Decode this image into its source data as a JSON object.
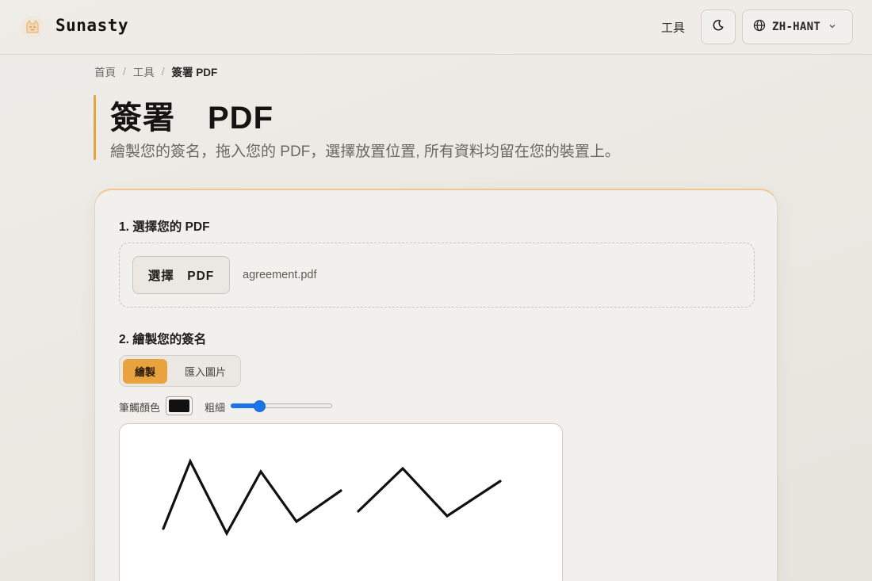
{
  "header": {
    "brand": "Sunasty",
    "nav_tools": "工具",
    "language": "ZH-HANT",
    "icons": {
      "logo": "cat-logo-icon",
      "theme": "moon-icon",
      "language": "globe-icon",
      "dropdown": "chevron-down-icon"
    }
  },
  "breadcrumb": {
    "home": "首頁",
    "tools": "工具",
    "current": "簽署 PDF",
    "separator": "/"
  },
  "page": {
    "title": "簽署　PDF",
    "subtitle": "繪製您的簽名，拖入您的 PDF，選擇放置位置, 所有資料均留在您的裝置上。"
  },
  "step1": {
    "title": "1. 選擇您的 PDF",
    "choose_label": "選擇　PDF",
    "file_name": "agreement.pdf"
  },
  "step2": {
    "title": "2. 繪製您的簽名",
    "tab_draw": "繪製",
    "tab_import": "匯入圖片",
    "color_label": "筆觸顏色",
    "stroke_color": "#111111",
    "width_label": "粗細",
    "width_level": 0.26
  },
  "colors": {
    "accent": "#e8a23e",
    "slider": "#1a73e8"
  }
}
